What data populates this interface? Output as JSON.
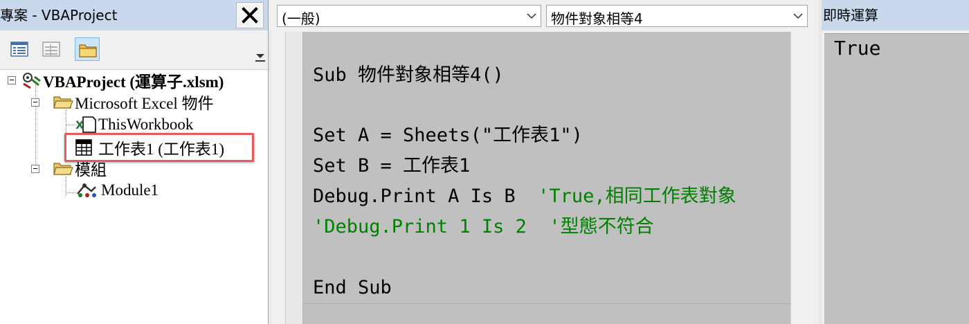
{
  "project_explorer": {
    "title": "專案 - VBAProject",
    "close_label": "X",
    "toolbar": {
      "view_code_icon": "view-code-icon",
      "view_object_icon": "view-object-icon",
      "toggle_folders_icon": "folder-icon"
    },
    "tree": {
      "root": "VBAProject (運算子.xlsm)",
      "excel_objects_folder": "Microsoft Excel 物件",
      "workbook": "ThisWorkbook",
      "sheet": "工作表1 (工作表1)",
      "modules_folder": "模組",
      "module": "Module1"
    }
  },
  "code_window": {
    "object_combo": "(一般)",
    "procedure_combo": "物件對象相等4",
    "lines": {
      "l1": "Sub 物件對象相等4()",
      "l2": "Set A = Sheets(\"工作表1\")",
      "l3": "Set B = 工作表1",
      "l4_code": "Debug.Print A Is B  ",
      "l4_comment": "'True,相同工作表對象",
      "l5_comment": "'Debug.Print 1 Is 2  '型態不符合",
      "l6": "End Sub"
    }
  },
  "immediate_window": {
    "title": "即時運算",
    "output": "True"
  },
  "colors": {
    "title_bar": "#c9d8ec",
    "code_background": "#c0c0c0",
    "comment": "#008000",
    "highlight_border": "#e45c5c"
  }
}
